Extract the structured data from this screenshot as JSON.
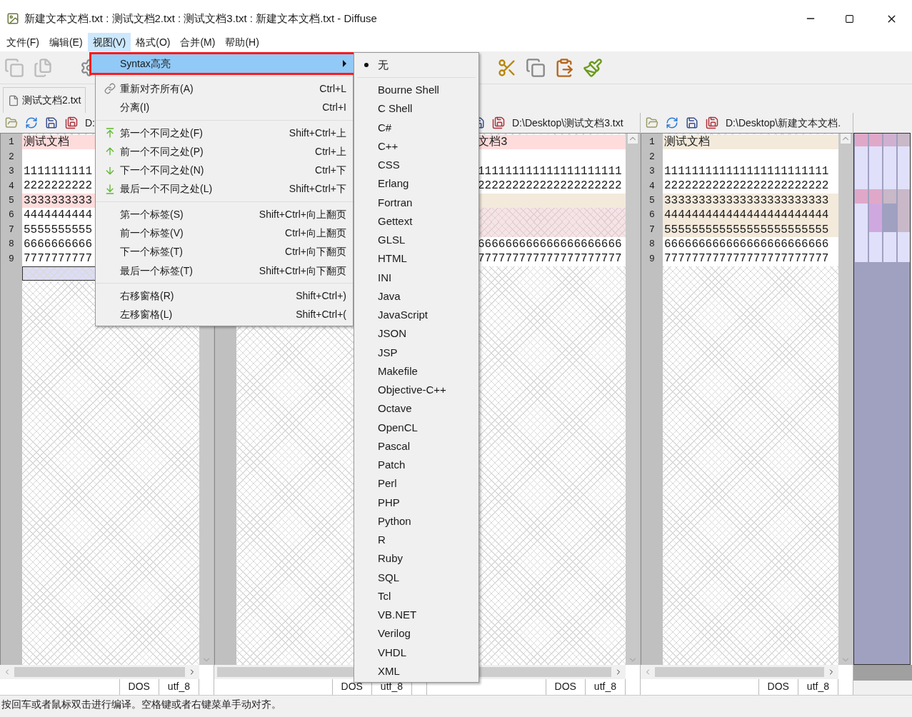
{
  "window": {
    "title": "新建文本文档.txt : 测试文档2.txt : 测试文档3.txt : 新建文本文档.txt - Diffuse"
  },
  "menu_bar": [
    {
      "label": "文件(F)",
      "selected": false
    },
    {
      "label": "编辑(E)",
      "selected": false
    },
    {
      "label": "视图(V)",
      "selected": true
    },
    {
      "label": "格式(O)",
      "selected": false
    },
    {
      "label": "合并(M)",
      "selected": false
    },
    {
      "label": "帮助(H)",
      "selected": false
    }
  ],
  "tabs": [
    {
      "label": "测试文档2.txt",
      "selected": true
    }
  ],
  "panes": [
    {
      "path": "D:",
      "lines": [
        {
          "number": "1",
          "text": "测试文档",
          "kind": "changed"
        },
        {
          "number": "2",
          "kind": "normal"
        },
        {
          "number": "3",
          "text": "1111111111",
          "kind": "normal"
        },
        {
          "number": "4",
          "text": "2222222222",
          "kind": "normal"
        },
        {
          "number": "5",
          "text": "3333333333",
          "kind": "changed"
        },
        {
          "number": "6",
          "text": "4444444444",
          "kind": "normal"
        },
        {
          "number": "7",
          "text": "5555555555",
          "kind": "normal"
        },
        {
          "number": "8",
          "text": "6666666666",
          "kind": "normal"
        },
        {
          "number": "9",
          "text": "7777777777",
          "kind": "normal"
        },
        {
          "kind": "cursor"
        }
      ],
      "format": "DOS",
      "encoding": "utf_8"
    },
    {
      "format": "DOS",
      "encoding": "utf_8"
    },
    {
      "path": "D:\\Desktop\\测试文档3.txt",
      "lines": [
        {
          "text": "文档3",
          "kind": "changed"
        },
        {
          "kind": "normal"
        },
        {
          "text": "111111111111111111111",
          "kind": "normal"
        },
        {
          "text": "222222222222222222222",
          "kind": "normal"
        },
        {
          "kind": "modified"
        },
        {
          "kind": "missing"
        },
        {
          "kind": "missing"
        },
        {
          "text": "666666666666666666666",
          "kind": "normal"
        },
        {
          "text": "777777777777777777777",
          "kind": "normal"
        }
      ],
      "format": "DOS",
      "encoding": "utf_8"
    },
    {
      "path": "D:\\Desktop\\新建文本文档.",
      "lines": [
        {
          "number": "1",
          "text": "测试文档",
          "kind": "modified"
        },
        {
          "number": "2",
          "kind": "normal"
        },
        {
          "number": "3",
          "text": "111111111111111111111111",
          "kind": "normal"
        },
        {
          "number": "4",
          "text": "222222222222222222222222",
          "kind": "normal"
        },
        {
          "number": "5",
          "text": "333333333333333333333333",
          "kind": "modified"
        },
        {
          "number": "6",
          "text": "444444444444444444444444",
          "kind": "modified"
        },
        {
          "number": "7",
          "text": "555555555555555555555555",
          "kind": "modified"
        },
        {
          "number": "8",
          "text": "666666666666666666666666",
          "kind": "normal"
        },
        {
          "number": "9",
          "text": "777777777777777777777777",
          "kind": "normal"
        }
      ],
      "format": "DOS",
      "encoding": "utf_8"
    }
  ],
  "view_menu": {
    "groups": [
      [
        {
          "label": "Syntax高亮",
          "selected": true,
          "kind": "submenu"
        }
      ],
      [
        {
          "label": "重新对齐所有(A)",
          "shortcut": "Ctrl+L",
          "selected": false,
          "kind": "item"
        },
        {
          "label": "分离(I)",
          "shortcut": "Ctrl+I",
          "selected": false,
          "kind": "item"
        }
      ],
      [
        {
          "label": "第一个不同之处(F)",
          "shortcut": "Shift+Ctrl+上",
          "selected": false,
          "kind": "item"
        },
        {
          "label": "前一个不同之处(P)",
          "shortcut": "Ctrl+上",
          "selected": false,
          "kind": "item"
        },
        {
          "label": "下一个不同之处(N)",
          "shortcut": "Ctrl+下",
          "selected": false,
          "kind": "item"
        },
        {
          "label": "最后一个不同之处(L)",
          "shortcut": "Shift+Ctrl+下",
          "selected": false,
          "kind": "item"
        }
      ],
      [
        {
          "label": "第一个标签(S)",
          "shortcut": "Shift+Ctrl+向上翻页",
          "selected": false,
          "kind": "item"
        },
        {
          "label": "前一个标签(V)",
          "shortcut": "Ctrl+向上翻页",
          "selected": false,
          "kind": "item"
        },
        {
          "label": "下一个标签(T)",
          "shortcut": "Ctrl+向下翻页",
          "selected": false,
          "kind": "item"
        },
        {
          "label": "最后一个标签(T)",
          "shortcut": "Shift+Ctrl+向下翻页",
          "selected": false,
          "kind": "item"
        }
      ],
      [
        {
          "label": "右移窗格(R)",
          "shortcut": "Shift+Ctrl+)",
          "selected": false,
          "kind": "item"
        },
        {
          "label": "左移窗格(L)",
          "shortcut": "Shift+Ctrl+(",
          "selected": false,
          "kind": "item"
        }
      ]
    ]
  },
  "syntax_menu": [
    {
      "label": "无",
      "selected": true
    },
    {
      "label": "Bourne Shell",
      "selected": false
    },
    {
      "label": "C Shell",
      "selected": false
    },
    {
      "label": "C#",
      "selected": false
    },
    {
      "label": "C++",
      "selected": false
    },
    {
      "label": "CSS",
      "selected": false
    },
    {
      "label": "Erlang",
      "selected": false
    },
    {
      "label": "Fortran",
      "selected": false
    },
    {
      "label": "Gettext",
      "selected": false
    },
    {
      "label": "GLSL",
      "selected": false
    },
    {
      "label": "HTML",
      "selected": false
    },
    {
      "label": "INI",
      "selected": false
    },
    {
      "label": "Java",
      "selected": false
    },
    {
      "label": "JavaScript",
      "selected": false
    },
    {
      "label": "JSON",
      "selected": false
    },
    {
      "label": "JSP",
      "selected": false
    },
    {
      "label": "Makefile",
      "selected": false
    },
    {
      "label": "Objective-C++",
      "selected": false
    },
    {
      "label": "Octave",
      "selected": false
    },
    {
      "label": "OpenCL",
      "selected": false
    },
    {
      "label": "Pascal",
      "selected": false
    },
    {
      "label": "Patch",
      "selected": false
    },
    {
      "label": "Perl",
      "selected": false
    },
    {
      "label": "PHP",
      "selected": false
    },
    {
      "label": "Python",
      "selected": false
    },
    {
      "label": "R",
      "selected": false
    },
    {
      "label": "Ruby",
      "selected": false
    },
    {
      "label": "SQL",
      "selected": false
    },
    {
      "label": "Tcl",
      "selected": false
    },
    {
      "label": "VB.NET",
      "selected": false
    },
    {
      "label": "Verilog",
      "selected": false
    },
    {
      "label": "VHDL",
      "selected": false
    },
    {
      "label": "XML",
      "selected": false
    }
  ],
  "status_bar": {
    "text": "按回车或者鼠标双击进行编译。空格键或者右键菜单手动对齐。"
  }
}
